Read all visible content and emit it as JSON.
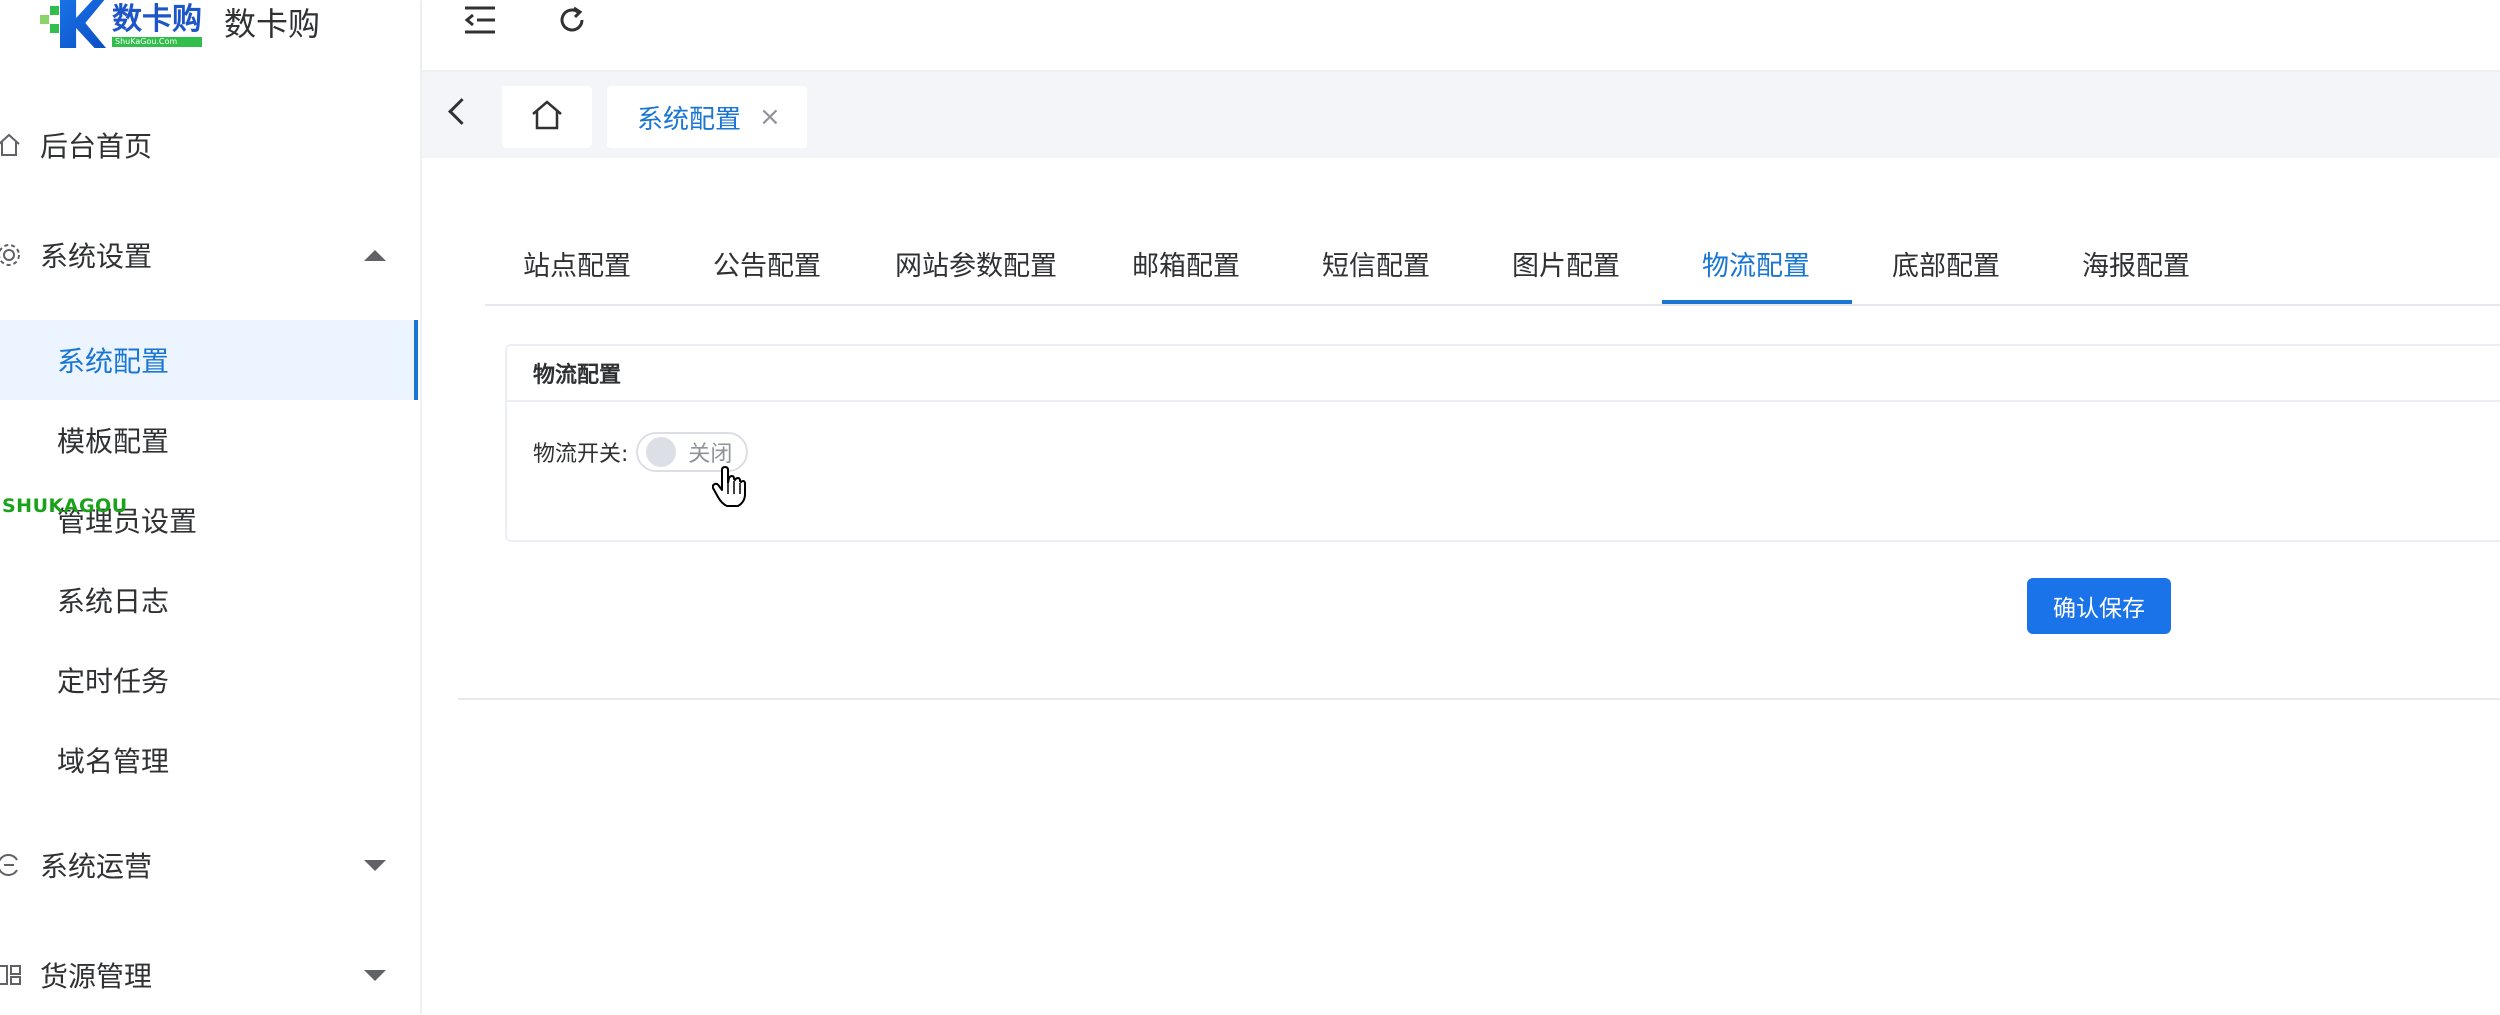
{
  "brand": {
    "logo_cn": "数卡购",
    "logo_en": "ShuKaGou.Com",
    "title": "数卡购"
  },
  "watermark": "SHUKAGOU",
  "sidebar": {
    "items": [
      {
        "label": "后台首页",
        "icon": "home-icon"
      },
      {
        "label": "系统设置",
        "icon": "gear-icon",
        "expanded": true
      },
      {
        "label": "系统运营",
        "icon": "operation-icon",
        "expanded": false
      },
      {
        "label": "货源管理",
        "icon": "grid-icon",
        "expanded": false
      }
    ],
    "sub_items": [
      {
        "label": "系统配置",
        "active": true
      },
      {
        "label": "模板配置"
      },
      {
        "label": "管理员设置"
      },
      {
        "label": "系统日志"
      },
      {
        "label": "定时任务"
      },
      {
        "label": "域名管理"
      }
    ]
  },
  "tagsbar": {
    "active_tag": "系统配置",
    "close_glyph": "×"
  },
  "tabs": [
    {
      "label": "站点配置"
    },
    {
      "label": "公告配置"
    },
    {
      "label": "网站参数配置"
    },
    {
      "label": "邮箱配置"
    },
    {
      "label": "短信配置"
    },
    {
      "label": "图片配置"
    },
    {
      "label": "物流配置",
      "active": true
    },
    {
      "label": "底部配置"
    },
    {
      "label": "海报配置"
    }
  ],
  "card": {
    "title": "物流配置",
    "field_label": "物流开关:",
    "switch_text": "关闭",
    "switch_on": false
  },
  "actions": {
    "save_label": "确认保存"
  },
  "colors": {
    "accent": "#1976d2",
    "active_bg": "#ecf5ff",
    "button": "#1a73e8",
    "watermark": "#1aa31a"
  }
}
